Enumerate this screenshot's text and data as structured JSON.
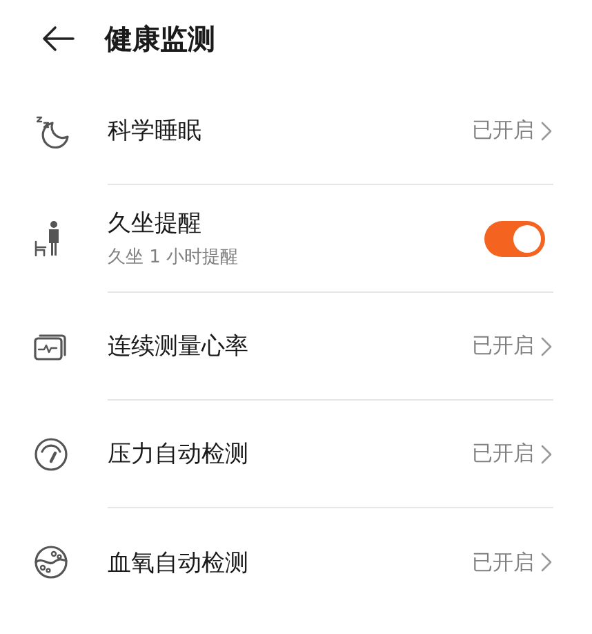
{
  "header": {
    "title": "健康监测"
  },
  "rows": [
    {
      "kind": "link",
      "title": "科学睡眠",
      "status": "已开启"
    },
    {
      "kind": "switch",
      "title": "久坐提醒",
      "subtitle": "久坐 1 小时提醒",
      "on": true
    },
    {
      "kind": "link",
      "title": "连续测量心率",
      "status": "已开启"
    },
    {
      "kind": "link",
      "title": "压力自动检测",
      "status": "已开启"
    },
    {
      "kind": "link",
      "title": "血氧自动检测",
      "status": "已开启"
    }
  ]
}
